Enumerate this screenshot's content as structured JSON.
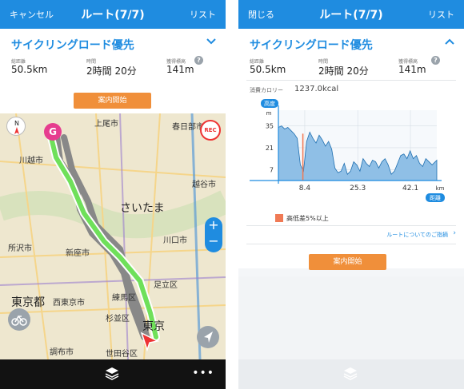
{
  "left": {
    "topbar": {
      "cancel": "キャンセル",
      "title": "ルート(7/7)",
      "list": "リスト"
    },
    "route": {
      "name": "サイクリングロード優先",
      "chevron": "⌄"
    },
    "stats": {
      "distance_label": "総距離",
      "distance_value": "50.5km",
      "time_label": "時間",
      "time_value": "2時間 20分",
      "elevation_label": "獲得標高",
      "elevation_value": "141m"
    },
    "start_button": "案内開始",
    "map": {
      "labels": [
        "上尾市",
        "春日部市",
        "川越市",
        "越谷市",
        "さいたま",
        "所沢市",
        "新座市",
        "川口市",
        "東京都",
        "西東京市",
        "練馬区",
        "杉並区",
        "調布市",
        "世田谷区",
        "東京",
        "足立区"
      ],
      "compass": "N",
      "goal_marker": "G",
      "rec": "REC",
      "zoom_in": "+",
      "zoom_out": "−"
    },
    "bottombar": {
      "more": "•••"
    }
  },
  "right": {
    "topbar": {
      "close": "閉じる",
      "title": "ルート(7/7)",
      "list": "リスト"
    },
    "route": {
      "name": "サイクリングロード優先",
      "chevron": "⌃"
    },
    "stats": {
      "distance_label": "総距離",
      "distance_value": "50.5km",
      "time_label": "時間",
      "time_value": "2時間 20分",
      "elevation_label": "獲得標高",
      "elevation_value": "141m"
    },
    "calorie_label": "消費カロリー",
    "calorie_value": "1237.0kcal",
    "legend_text": "高低差5%以上",
    "info_link": "ルートについてのご指摘",
    "start_button": "案内開始"
  },
  "chart_data": {
    "type": "area",
    "ylabel_badge": "高度",
    "yunit": "m",
    "xunit": "km",
    "xlabel_badge": "距離",
    "yticks": [
      7,
      21,
      35
    ],
    "xticks": [
      8.4,
      25.3,
      42.1
    ],
    "xlim": [
      0,
      50.5
    ],
    "ylim": [
      0,
      45
    ],
    "series": [
      {
        "x": [
          0,
          1,
          2,
          3,
          4,
          5,
          6,
          7,
          8,
          9,
          10,
          11,
          12,
          13,
          14,
          15,
          16,
          17,
          18,
          19,
          20,
          21,
          22,
          23,
          24,
          25,
          26,
          27,
          28,
          29,
          30,
          31,
          32,
          33,
          34,
          35,
          36,
          37,
          38,
          39,
          40,
          41,
          42,
          43,
          44,
          45,
          46,
          47,
          48,
          49,
          50.5
        ],
        "values": [
          34,
          35,
          33,
          34,
          32,
          30,
          27,
          10,
          6,
          25,
          31,
          27,
          24,
          29,
          26,
          22,
          25,
          20,
          8,
          5,
          6,
          11,
          4,
          6,
          12,
          10,
          6,
          14,
          11,
          9,
          13,
          12,
          8,
          12,
          14,
          10,
          4,
          6,
          11,
          16,
          17,
          14,
          19,
          14,
          16,
          11,
          9,
          14,
          12,
          10,
          13
        ]
      }
    ],
    "highlight_ranges": [
      [
        7.6,
        8.0
      ]
    ]
  }
}
